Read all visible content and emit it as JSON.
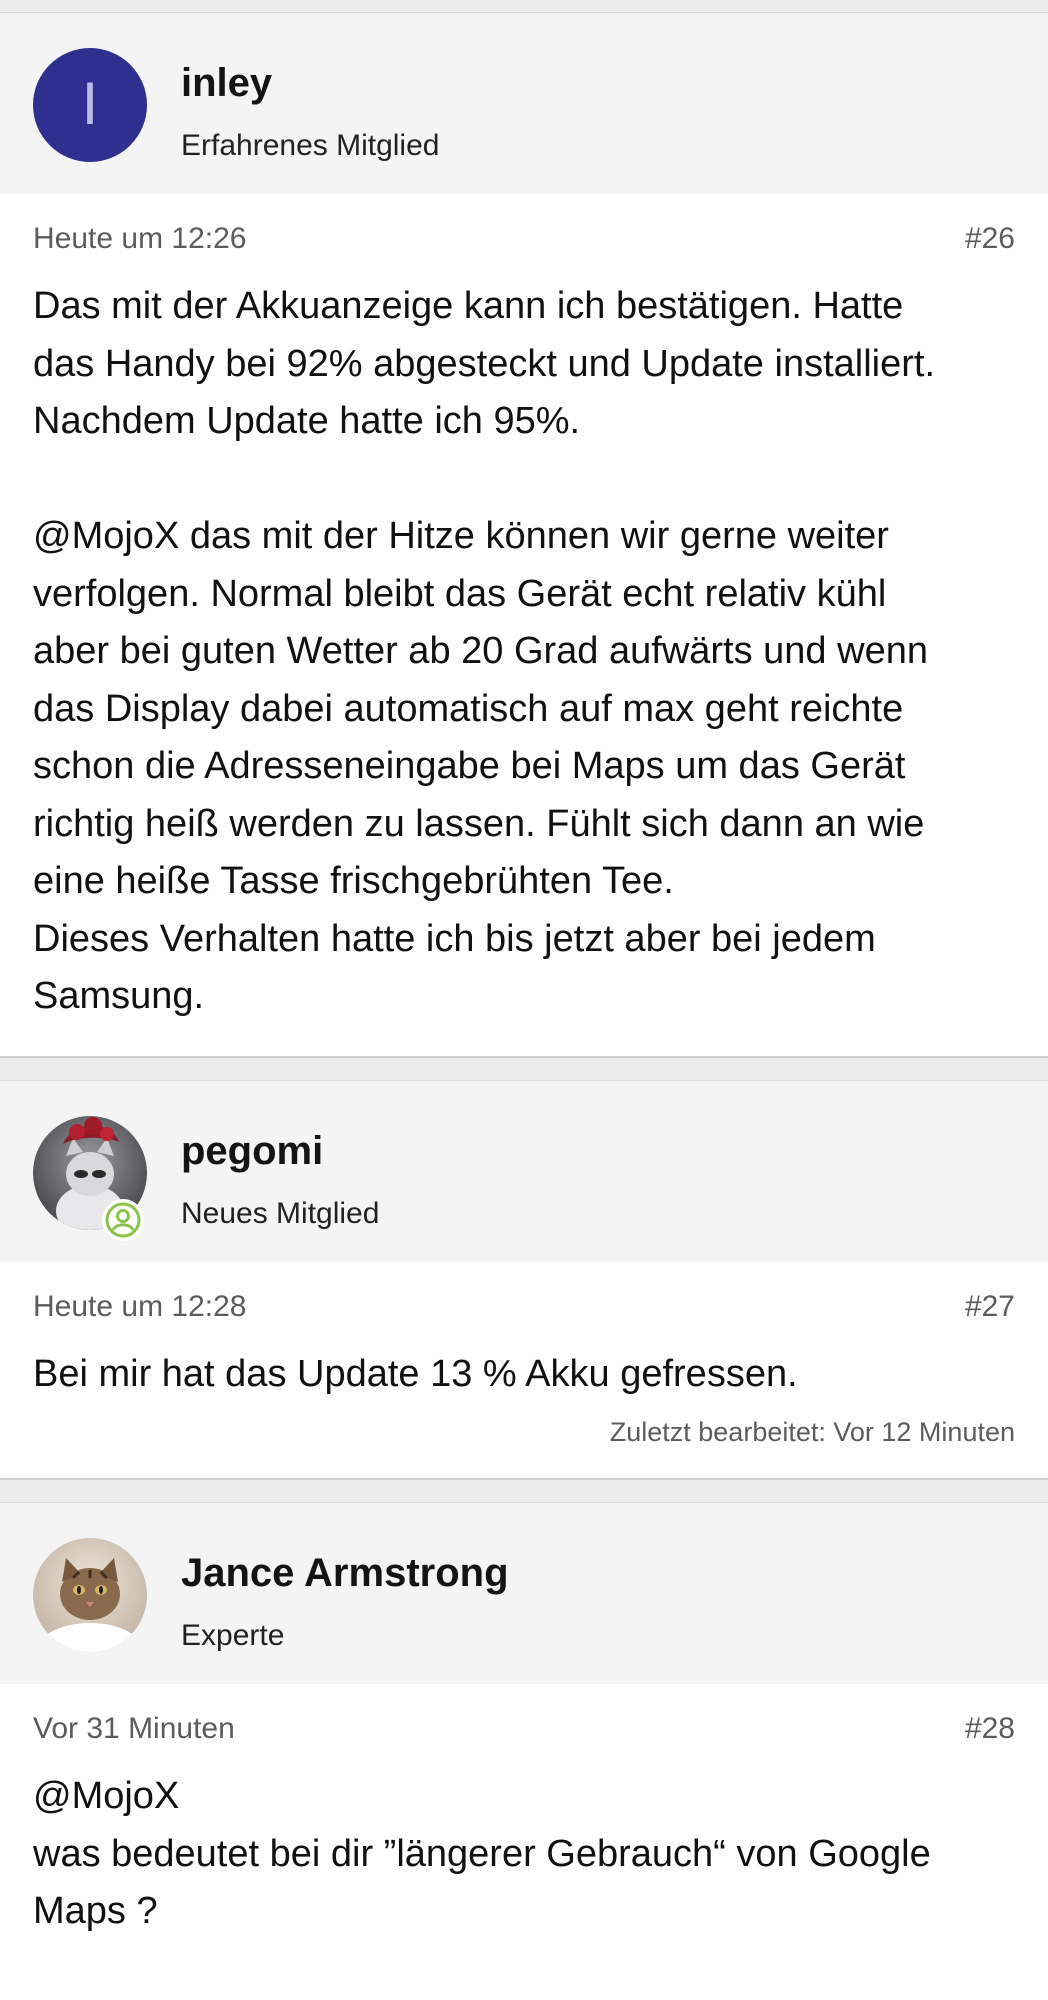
{
  "posts": [
    {
      "username": "inley",
      "rank": "Erfahrenes Mitglied",
      "avatar_letter": "I",
      "avatar_color": "#2f2f8f",
      "timestamp": "Heute um 12:26",
      "post_number": "#26",
      "content": "Das mit der Akkuanzeige kann ich bestätigen. Hatte\ndas Handy bei 92% abgesteckt und Update installiert.\nNachdem Update hatte ich 95%.\n\n@MojoX das mit der Hitze können wir gerne weiter\nverfolgen. Normal bleibt das Gerät echt relativ kühl\naber bei guten Wetter ab 20 Grad aufwärts und wenn\ndas Display dabei automatisch auf max geht reichte\nschon die Adresseneingabe bei Maps um das Gerät\nrichtig heiß werden zu lassen. Fühlt sich dann an wie\neine heiße Tasse frischgebrühten Tee.\nDieses Verhalten hatte ich bis jetzt aber bei jedem\nSamsung."
    },
    {
      "username": "pegomi",
      "rank": "Neues Mitglied",
      "avatar_icon": "cat-with-red-hat-avatar",
      "badge_icon": "new-member-user-icon",
      "badge_color": "#8bc34a",
      "timestamp": "Heute um 12:28",
      "post_number": "#27",
      "content": "Bei mir hat das Update 13 % Akku gefressen.",
      "edited_note": "Zuletzt bearbeitet: Vor 12 Minuten"
    },
    {
      "username": "Jance Armstrong",
      "rank": "Experte",
      "avatar_icon": "tabby-cat-avatar",
      "timestamp": "Vor 31 Minuten",
      "post_number": "#28",
      "content": "@MojoX\nwas bedeutet bei dir ”längerer Gebrauch“ von Google\nMaps ?"
    }
  ]
}
